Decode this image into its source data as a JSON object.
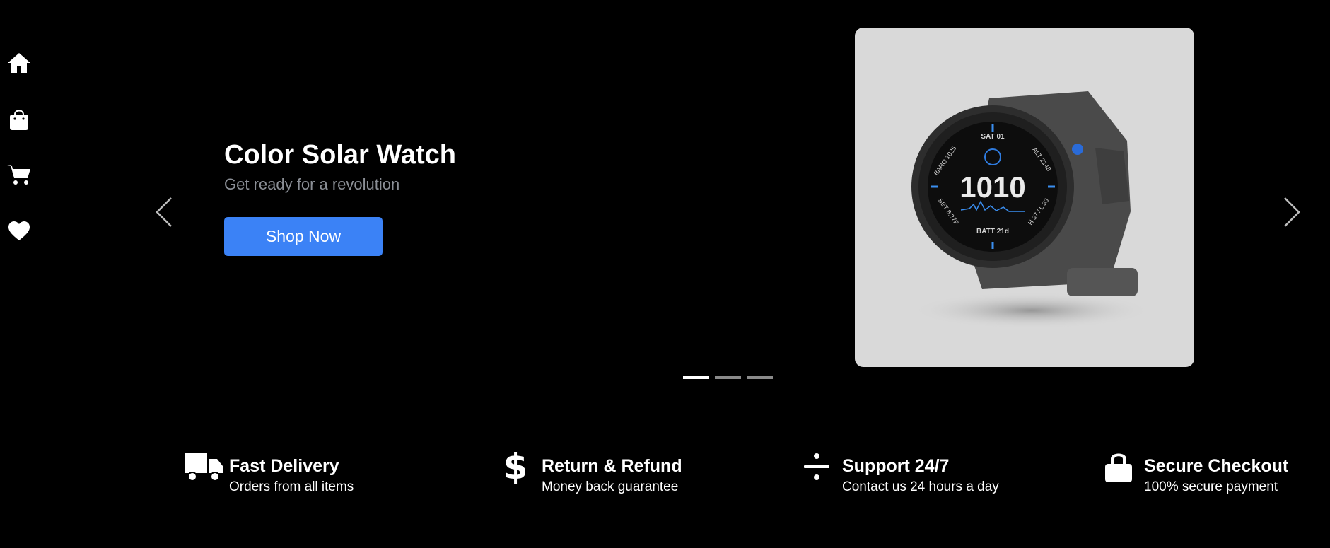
{
  "sidebar": {
    "items": [
      {
        "icon": "home-icon"
      },
      {
        "icon": "shopping-bag-icon"
      },
      {
        "icon": "cart-icon"
      },
      {
        "icon": "heart-icon"
      }
    ]
  },
  "hero": {
    "title": "Color Solar Watch",
    "subtitle": "Get ready for a revolution",
    "cta_label": "Shop Now",
    "slide_count": 3,
    "active_slide": 1,
    "product_image": "smartwatch-image",
    "watch_face": {
      "time": "1010",
      "top": "SAT 01",
      "left_top": "BARO 1025",
      "right_top": "ALT 2148",
      "left_bottom": "SET 8:37P",
      "right_bottom": "H 37 / L 33",
      "bottom": "BATT 21d"
    }
  },
  "features": [
    {
      "icon": "truck-icon",
      "title": "Fast Delivery",
      "subtitle": "Orders from all items"
    },
    {
      "icon": "dollar-icon",
      "title": "Return & Refund",
      "subtitle": "Money back guarantee"
    },
    {
      "icon": "divide-icon",
      "title": "Support 24/7",
      "subtitle": "Contact us 24 hours a day"
    },
    {
      "icon": "lock-icon",
      "title": "Secure Checkout",
      "subtitle": "100% secure payment"
    }
  ],
  "colors": {
    "background": "#000000",
    "accent": "#3b82f6",
    "subtitle": "#8b8f96",
    "card": "#d9d9d9"
  }
}
